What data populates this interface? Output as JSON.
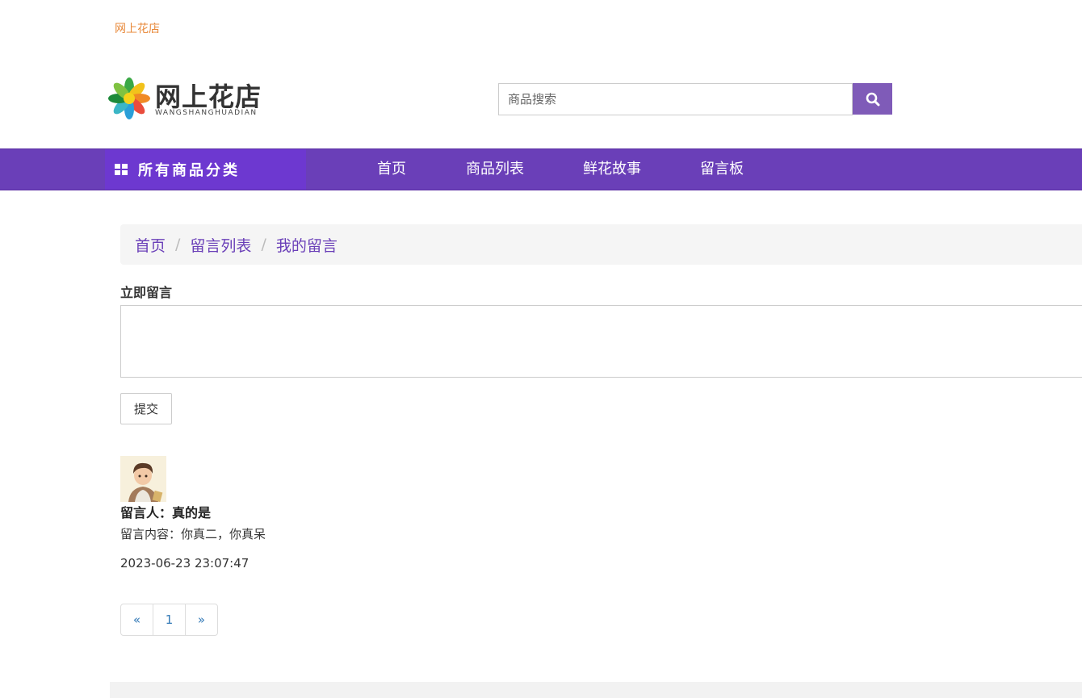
{
  "top_link": "网上花店",
  "logo": {
    "name_cn": "网上花店",
    "name_en": "WANGSHANGHUADIAN"
  },
  "search": {
    "placeholder": "商品搜索",
    "icon": "search-icon"
  },
  "nav": {
    "category_label": "所有商品分类",
    "items": [
      "首页",
      "商品列表",
      "鲜花故事",
      "留言板"
    ]
  },
  "breadcrumb": [
    "首页",
    "留言列表",
    "我的留言"
  ],
  "form": {
    "label": "立即留言",
    "submit_label": "提交"
  },
  "messages": [
    {
      "author": "留言人：真的是",
      "content": "留言内容：你真二，你真呆",
      "time": "2023-06-23 23:07:47"
    }
  ],
  "pagination": {
    "prev": "«",
    "current": "1",
    "next": "»"
  },
  "colors": {
    "brand_purple": "#6a3fb8",
    "category_purple": "#6d38d0",
    "top_link_orange": "#e8893a"
  }
}
